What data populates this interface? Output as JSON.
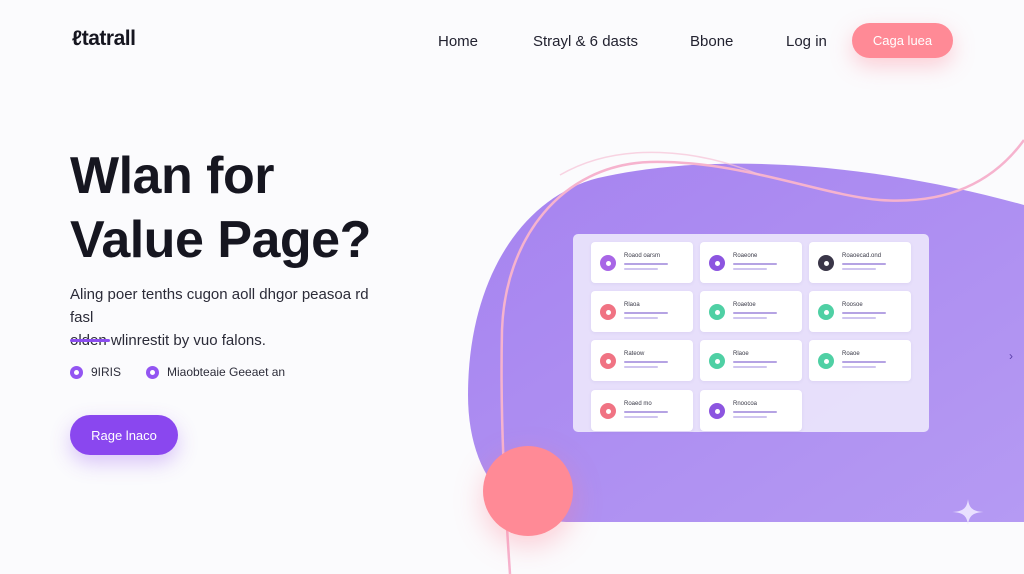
{
  "nav": {
    "brand": "ℓtatrall",
    "links": [
      "Home",
      "Strayl & 6 dasts",
      "Bbone",
      "Log in"
    ],
    "cta": "Caga luea"
  },
  "hero": {
    "title_line1": "Wlan for",
    "title_line2": "Value Page?",
    "subtitle_line1": "Aling poer tenths cugon aoll dhgor peasoa rd fasl",
    "subtitle_line2": "olden wlinrestit by vuo falons.",
    "features": [
      "9IRIS",
      "Miaobteaie Geeaet an"
    ],
    "cta": "Rage lnaco"
  },
  "dashboard": {
    "cards": [
      {
        "title": "Roaod oarsm",
        "color": "#a866e6"
      },
      {
        "title": "Roaeone",
        "color": "#8c55e0"
      },
      {
        "title": "Roaoecad.ond",
        "color": "#3a3648"
      },
      {
        "title": "Rlaoa",
        "color": "#f07383"
      },
      {
        "title": "Roaetoe",
        "color": "#4fd0a4"
      },
      {
        "title": "Roosoe",
        "color": "#4fd0a4"
      },
      {
        "title": "Rateow",
        "color": "#f07383"
      },
      {
        "title": "Rlaoe",
        "color": "#4fd0a4"
      },
      {
        "title": "Roaoe",
        "color": "#4fd0a4"
      },
      {
        "title": "Roaed mo",
        "color": "#f07383"
      },
      {
        "title": "Rnoocoa",
        "color": "#8c55e0"
      }
    ]
  },
  "colors": {
    "accent_purple": "#8a47ef",
    "accent_coral": "#ff8a96",
    "blob_purple": "#b190f2"
  },
  "icons": [
    "dot-icon",
    "chevron-right-icon",
    "sparkle-icon"
  ]
}
